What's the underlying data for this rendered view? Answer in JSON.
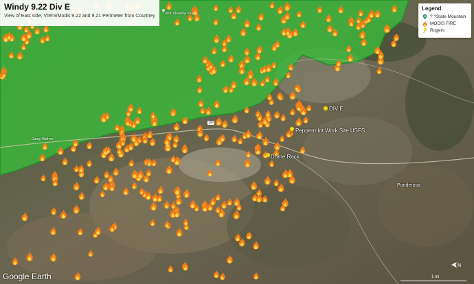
{
  "title": "Windy 9.22 Div E",
  "subtitle": "View of East side, VIIRS/Modis 9.22 and 9.21 Perimeter from Courtney",
  "legend": {
    "title": "Legend",
    "items": [
      {
        "label": "? ?Slate Mountain",
        "icon": "map-pin-icon",
        "color": "#2a8a74"
      },
      {
        "label": "MODIS FIRE",
        "icon": "fire-icon",
        "color": "#f27d16"
      },
      {
        "label": "Rogers",
        "icon": "pushpin-icon",
        "color": "#f2d618"
      }
    ]
  },
  "places": [
    {
      "name": "DIV E",
      "icon": "pushpin-icon"
    },
    {
      "name": "Peppermint Work Site USFS",
      "icon": "pushpin-icon"
    },
    {
      "name": "Dome Rock",
      "icon": "pushpin-icon"
    }
  ],
  "map_labels": {
    "ponderosa": "Ponderosa",
    "peak": "Dixon Meadow Peak",
    "campground": "Camp Wishon",
    "road_shield": "190"
  },
  "perimeter_color": "#3ab83a",
  "fire_color": "#f27d16",
  "watermark": "Google Earth",
  "scale_label": "1 mi",
  "compass_label": "N"
}
